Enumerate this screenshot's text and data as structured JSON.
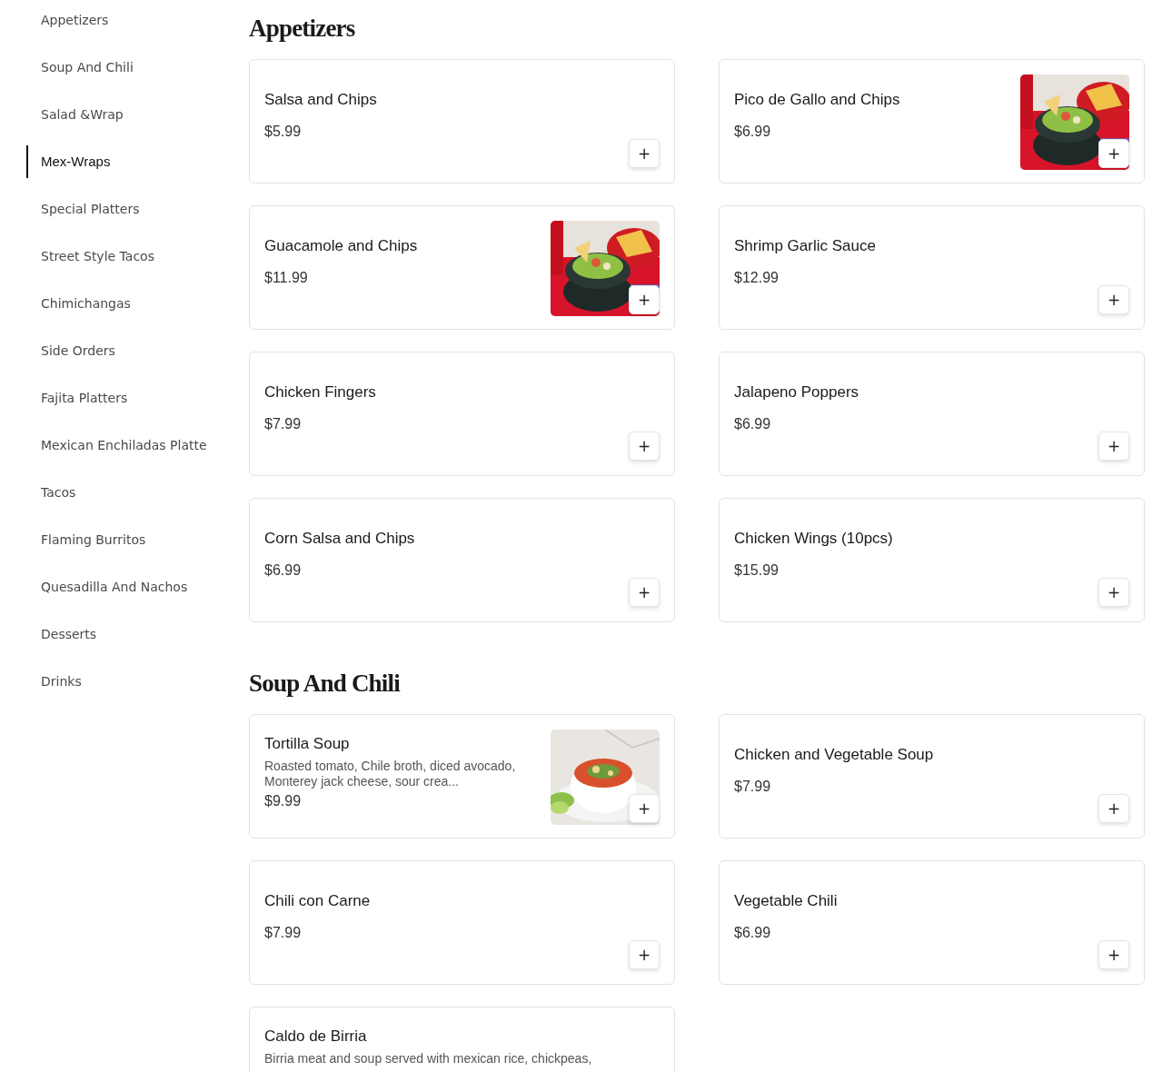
{
  "sidebar": {
    "items": [
      {
        "label": "Appetizers",
        "selected": false
      },
      {
        "label": "Soup And Chili",
        "selected": false
      },
      {
        "label": "Salad &Wrap",
        "selected": false
      },
      {
        "label": "Mex-Wraps",
        "selected": true
      },
      {
        "label": "Special Platters",
        "selected": false
      },
      {
        "label": "Street Style Tacos",
        "selected": false
      },
      {
        "label": "Chimichangas",
        "selected": false
      },
      {
        "label": "Side Orders",
        "selected": false
      },
      {
        "label": "Fajita Platters",
        "selected": false
      },
      {
        "label": "Mexican Enchiladas Platte",
        "selected": false
      },
      {
        "label": "Tacos",
        "selected": false
      },
      {
        "label": "Flaming Burritos",
        "selected": false
      },
      {
        "label": "Quesadilla And Nachos",
        "selected": false
      },
      {
        "label": "Desserts",
        "selected": false
      },
      {
        "label": "Drinks",
        "selected": false
      }
    ]
  },
  "sections": [
    {
      "title": "Appetizers",
      "items": [
        {
          "name": "Salsa and Chips",
          "price": "$5.99",
          "add": "+"
        },
        {
          "name": "Pico de Gallo and Chips",
          "price": "$6.99",
          "add": "+"
        },
        {
          "name": "Guacamole and Chips",
          "price": "$11.99",
          "add": "+"
        },
        {
          "name": "Shrimp Garlic Sauce",
          "price": "$12.99",
          "add": "+"
        },
        {
          "name": "Chicken Fingers",
          "price": "$7.99",
          "add": "+"
        },
        {
          "name": "Jalapeno Poppers",
          "price": "$6.99",
          "add": "+"
        },
        {
          "name": "Corn Salsa and Chips",
          "price": "$6.99",
          "add": "+"
        },
        {
          "name": "Chicken Wings (10pcs)",
          "price": "$15.99",
          "add": "+"
        }
      ]
    },
    {
      "title": "Soup And Chili",
      "items": [
        {
          "name": "Tortilla Soup",
          "description": "Roasted tomato, Chile broth, diced avocado, Monterey jack cheese, sour crea...",
          "price": "$9.99",
          "add": "+"
        },
        {
          "name": "Chicken and Vegetable Soup",
          "price": "$7.99",
          "add": "+"
        },
        {
          "name": "Chili con Carne",
          "price": "$7.99",
          "add": "+"
        },
        {
          "name": "Vegetable Chili",
          "price": "$6.99",
          "add": "+"
        },
        {
          "name": "Caldo de Birria",
          "description": "Birria meat and soup served with mexican rice, chickpeas,"
        }
      ]
    }
  ]
}
